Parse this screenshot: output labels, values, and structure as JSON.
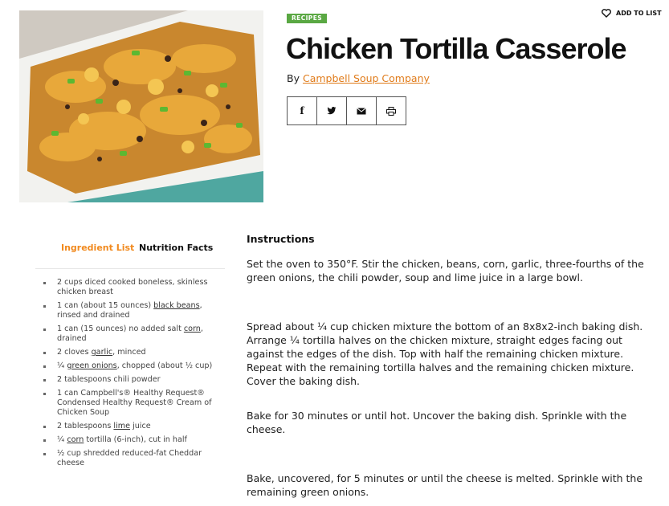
{
  "header": {
    "badge": "RECIPES",
    "add_to_list": "ADD TO LIST",
    "title": "Chicken Tortilla Casserole",
    "byline_prefix": "By",
    "author": "Campbell Soup Company"
  },
  "share_icons": [
    "facebook-icon",
    "twitter-icon",
    "email-icon",
    "print-icon"
  ],
  "tabs": {
    "ingredient_list": "Ingredient List",
    "nutrition_facts": "Nutrition Facts"
  },
  "ingredients": [
    {
      "pre": "2 cups diced cooked boneless, skinless chicken breast",
      "link": "",
      "post": ""
    },
    {
      "pre": "1 can (about 15 ounces) ",
      "link": "black beans",
      "post": ", rinsed and drained"
    },
    {
      "pre": "1 can (15 ounces) no added salt ",
      "link": "corn",
      "post": ", drained"
    },
    {
      "pre": "2 cloves ",
      "link": "garlic",
      "post": ", minced"
    },
    {
      "pre": "¼ ",
      "link": "green onions",
      "post": ", chopped (about ½ cup)"
    },
    {
      "pre": "2 tablespoons chili powder",
      "link": "",
      "post": ""
    },
    {
      "pre": "1 can Campbell's® Healthy Request® Condensed Healthy Request® Cream of Chicken Soup",
      "link": "",
      "post": ""
    },
    {
      "pre": "2 tablespoons ",
      "link": "lime",
      "post": " juice"
    },
    {
      "pre": "¼ ",
      "link": "corn",
      "post": " tortilla (6-inch), cut in half"
    },
    {
      "pre": "½ cup shredded reduced-fat Cheddar cheese",
      "link": "",
      "post": ""
    }
  ],
  "instructions": {
    "heading": "Instructions",
    "steps": [
      "Set the oven to 350°F.  Stir the chicken, beans, corn, garlic, three-fourths of the green onions, the chili powder, soup and lime juice in a large bowl.",
      "Spread about ¼ cup chicken mixture the bottom of an 8x8x2-inch baking dish.  Arrange ¼ tortilla halves on the chicken mixture, straight edges facing out against the edges of the dish.  Top with half the remaining chicken mixture. Repeat with the remaining tortilla halves and the remaining chicken mixture. Cover the baking dish.",
      "Bake for 30 minutes or until hot.  Uncover the baking dish.  Sprinkle with the cheese.",
      "Bake, uncovered, for 5 minutes or until the cheese is melted. Sprinkle with the remaining green onions."
    ]
  },
  "colors": {
    "accent": "#f18a1f",
    "badge": "#5aa843",
    "author_link": "#e07b1a"
  }
}
